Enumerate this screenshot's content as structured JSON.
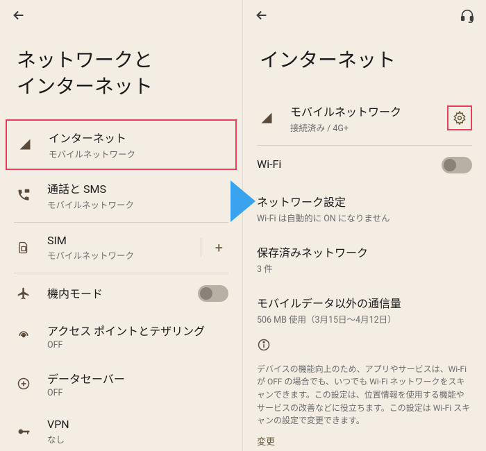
{
  "left": {
    "title": "ネットワークと\nインターネット",
    "items": {
      "internet": {
        "title": "インターネット",
        "sub": "モバイルネットワーク"
      },
      "calls": {
        "title": "通話と SMS",
        "sub": "モバイルネットワーク"
      },
      "sim": {
        "title": "SIM",
        "sub": "モバイルネットワーク"
      },
      "airplane": {
        "title": "機内モード"
      },
      "hotspot": {
        "title": "アクセス ポイントとテザリング",
        "sub": "OFF"
      },
      "datasaver": {
        "title": "データセーバー",
        "sub": "OFF"
      },
      "vpn": {
        "title": "VPN",
        "sub": "なし"
      }
    }
  },
  "right": {
    "title": "インターネット",
    "mobile": {
      "title": "モバイルネットワーク",
      "sub": "接続済み / 4G+"
    },
    "wifi": {
      "title": "Wi-Fi"
    },
    "netset": {
      "title": "ネットワーク設定",
      "sub": "Wi-Fi は自動的に ON になりません"
    },
    "saved": {
      "title": "保存済みネットワーク",
      "sub": "3 件"
    },
    "nonmobile": {
      "title": "モバイルデータ以外の通信量",
      "sub": "506 MB 使用（3月15日～4月12日）"
    },
    "info": "デバイスの機能向上のため、アプリやサービスは、Wi-Fi が OFF の場合でも、いつでも Wi-Fi ネットワークをスキャンできます。この設定は、位置情報を使用する機能やサービスの改善などに役立ちます。この設定は Wi-Fi スキャンの設定で変更できます。",
    "change": "変更"
  }
}
